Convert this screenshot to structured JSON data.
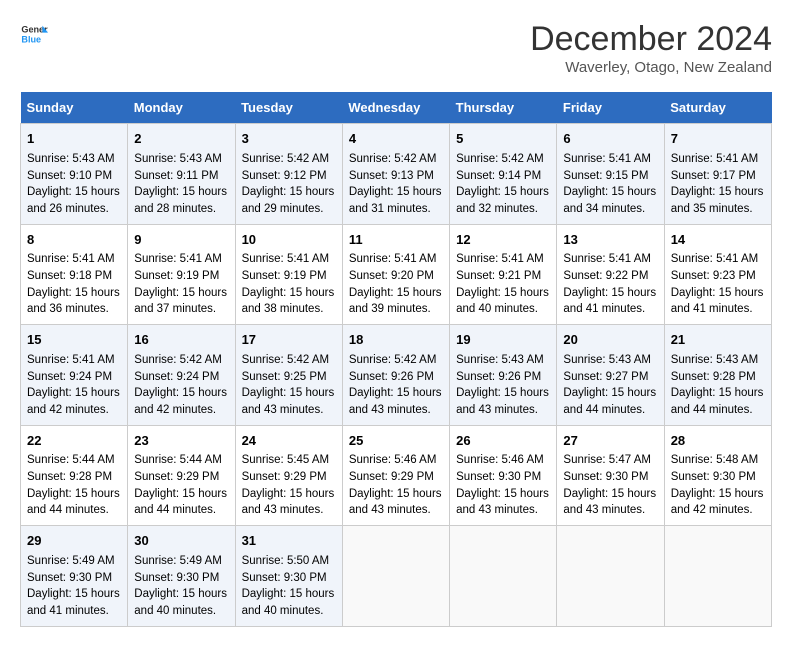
{
  "logo": {
    "line1": "General",
    "line2": "Blue"
  },
  "title": "December 2024",
  "subtitle": "Waverley, Otago, New Zealand",
  "days_of_week": [
    "Sunday",
    "Monday",
    "Tuesday",
    "Wednesday",
    "Thursday",
    "Friday",
    "Saturday"
  ],
  "weeks": [
    [
      {
        "day": "1",
        "sunrise": "5:43 AM",
        "sunset": "9:10 PM",
        "daylight": "15 hours and 26 minutes."
      },
      {
        "day": "2",
        "sunrise": "5:43 AM",
        "sunset": "9:11 PM",
        "daylight": "15 hours and 28 minutes."
      },
      {
        "day": "3",
        "sunrise": "5:42 AM",
        "sunset": "9:12 PM",
        "daylight": "15 hours and 29 minutes."
      },
      {
        "day": "4",
        "sunrise": "5:42 AM",
        "sunset": "9:13 PM",
        "daylight": "15 hours and 31 minutes."
      },
      {
        "day": "5",
        "sunrise": "5:42 AM",
        "sunset": "9:14 PM",
        "daylight": "15 hours and 32 minutes."
      },
      {
        "day": "6",
        "sunrise": "5:41 AM",
        "sunset": "9:15 PM",
        "daylight": "15 hours and 34 minutes."
      },
      {
        "day": "7",
        "sunrise": "5:41 AM",
        "sunset": "9:17 PM",
        "daylight": "15 hours and 35 minutes."
      }
    ],
    [
      {
        "day": "8",
        "sunrise": "5:41 AM",
        "sunset": "9:18 PM",
        "daylight": "15 hours and 36 minutes."
      },
      {
        "day": "9",
        "sunrise": "5:41 AM",
        "sunset": "9:19 PM",
        "daylight": "15 hours and 37 minutes."
      },
      {
        "day": "10",
        "sunrise": "5:41 AM",
        "sunset": "9:19 PM",
        "daylight": "15 hours and 38 minutes."
      },
      {
        "day": "11",
        "sunrise": "5:41 AM",
        "sunset": "9:20 PM",
        "daylight": "15 hours and 39 minutes."
      },
      {
        "day": "12",
        "sunrise": "5:41 AM",
        "sunset": "9:21 PM",
        "daylight": "15 hours and 40 minutes."
      },
      {
        "day": "13",
        "sunrise": "5:41 AM",
        "sunset": "9:22 PM",
        "daylight": "15 hours and 41 minutes."
      },
      {
        "day": "14",
        "sunrise": "5:41 AM",
        "sunset": "9:23 PM",
        "daylight": "15 hours and 41 minutes."
      }
    ],
    [
      {
        "day": "15",
        "sunrise": "5:41 AM",
        "sunset": "9:24 PM",
        "daylight": "15 hours and 42 minutes."
      },
      {
        "day": "16",
        "sunrise": "5:42 AM",
        "sunset": "9:24 PM",
        "daylight": "15 hours and 42 minutes."
      },
      {
        "day": "17",
        "sunrise": "5:42 AM",
        "sunset": "9:25 PM",
        "daylight": "15 hours and 43 minutes."
      },
      {
        "day": "18",
        "sunrise": "5:42 AM",
        "sunset": "9:26 PM",
        "daylight": "15 hours and 43 minutes."
      },
      {
        "day": "19",
        "sunrise": "5:43 AM",
        "sunset": "9:26 PM",
        "daylight": "15 hours and 43 minutes."
      },
      {
        "day": "20",
        "sunrise": "5:43 AM",
        "sunset": "9:27 PM",
        "daylight": "15 hours and 44 minutes."
      },
      {
        "day": "21",
        "sunrise": "5:43 AM",
        "sunset": "9:28 PM",
        "daylight": "15 hours and 44 minutes."
      }
    ],
    [
      {
        "day": "22",
        "sunrise": "5:44 AM",
        "sunset": "9:28 PM",
        "daylight": "15 hours and 44 minutes."
      },
      {
        "day": "23",
        "sunrise": "5:44 AM",
        "sunset": "9:29 PM",
        "daylight": "15 hours and 44 minutes."
      },
      {
        "day": "24",
        "sunrise": "5:45 AM",
        "sunset": "9:29 PM",
        "daylight": "15 hours and 43 minutes."
      },
      {
        "day": "25",
        "sunrise": "5:46 AM",
        "sunset": "9:29 PM",
        "daylight": "15 hours and 43 minutes."
      },
      {
        "day": "26",
        "sunrise": "5:46 AM",
        "sunset": "9:30 PM",
        "daylight": "15 hours and 43 minutes."
      },
      {
        "day": "27",
        "sunrise": "5:47 AM",
        "sunset": "9:30 PM",
        "daylight": "15 hours and 43 minutes."
      },
      {
        "day": "28",
        "sunrise": "5:48 AM",
        "sunset": "9:30 PM",
        "daylight": "15 hours and 42 minutes."
      }
    ],
    [
      {
        "day": "29",
        "sunrise": "5:49 AM",
        "sunset": "9:30 PM",
        "daylight": "15 hours and 41 minutes."
      },
      {
        "day": "30",
        "sunrise": "5:49 AM",
        "sunset": "9:30 PM",
        "daylight": "15 hours and 40 minutes."
      },
      {
        "day": "31",
        "sunrise": "5:50 AM",
        "sunset": "9:30 PM",
        "daylight": "15 hours and 40 minutes."
      },
      null,
      null,
      null,
      null
    ]
  ]
}
